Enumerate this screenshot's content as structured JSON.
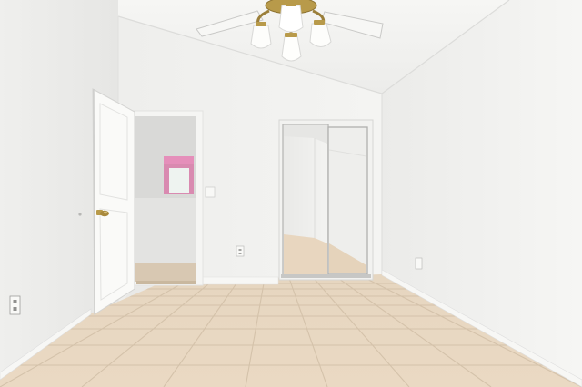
{
  "photo": {
    "kind": "empty-bedroom-interior",
    "watermark_text": "",
    "colors": {
      "wall_light": "#f2f2f0",
      "wall_shadow": "#e3e3e1",
      "ceiling": "#f5f5f3",
      "floor_tile": "#e8d8c2",
      "grout": "#d7c6af",
      "baseboard": "#f7f7f5",
      "door": "#fbfbf9",
      "window_tint": "#d98ab0",
      "brass": "#b89a4a"
    },
    "objects": [
      {
        "name": "ceiling-fan",
        "icon": "ceiling-fan-icon"
      },
      {
        "name": "open-door",
        "icon": "door-icon"
      },
      {
        "name": "mirrored-closet",
        "icon": "mirror-icon"
      },
      {
        "name": "wall-outlet",
        "icon": "outlet-icon"
      },
      {
        "name": "tile-floor",
        "icon": "floor-icon"
      }
    ]
  }
}
